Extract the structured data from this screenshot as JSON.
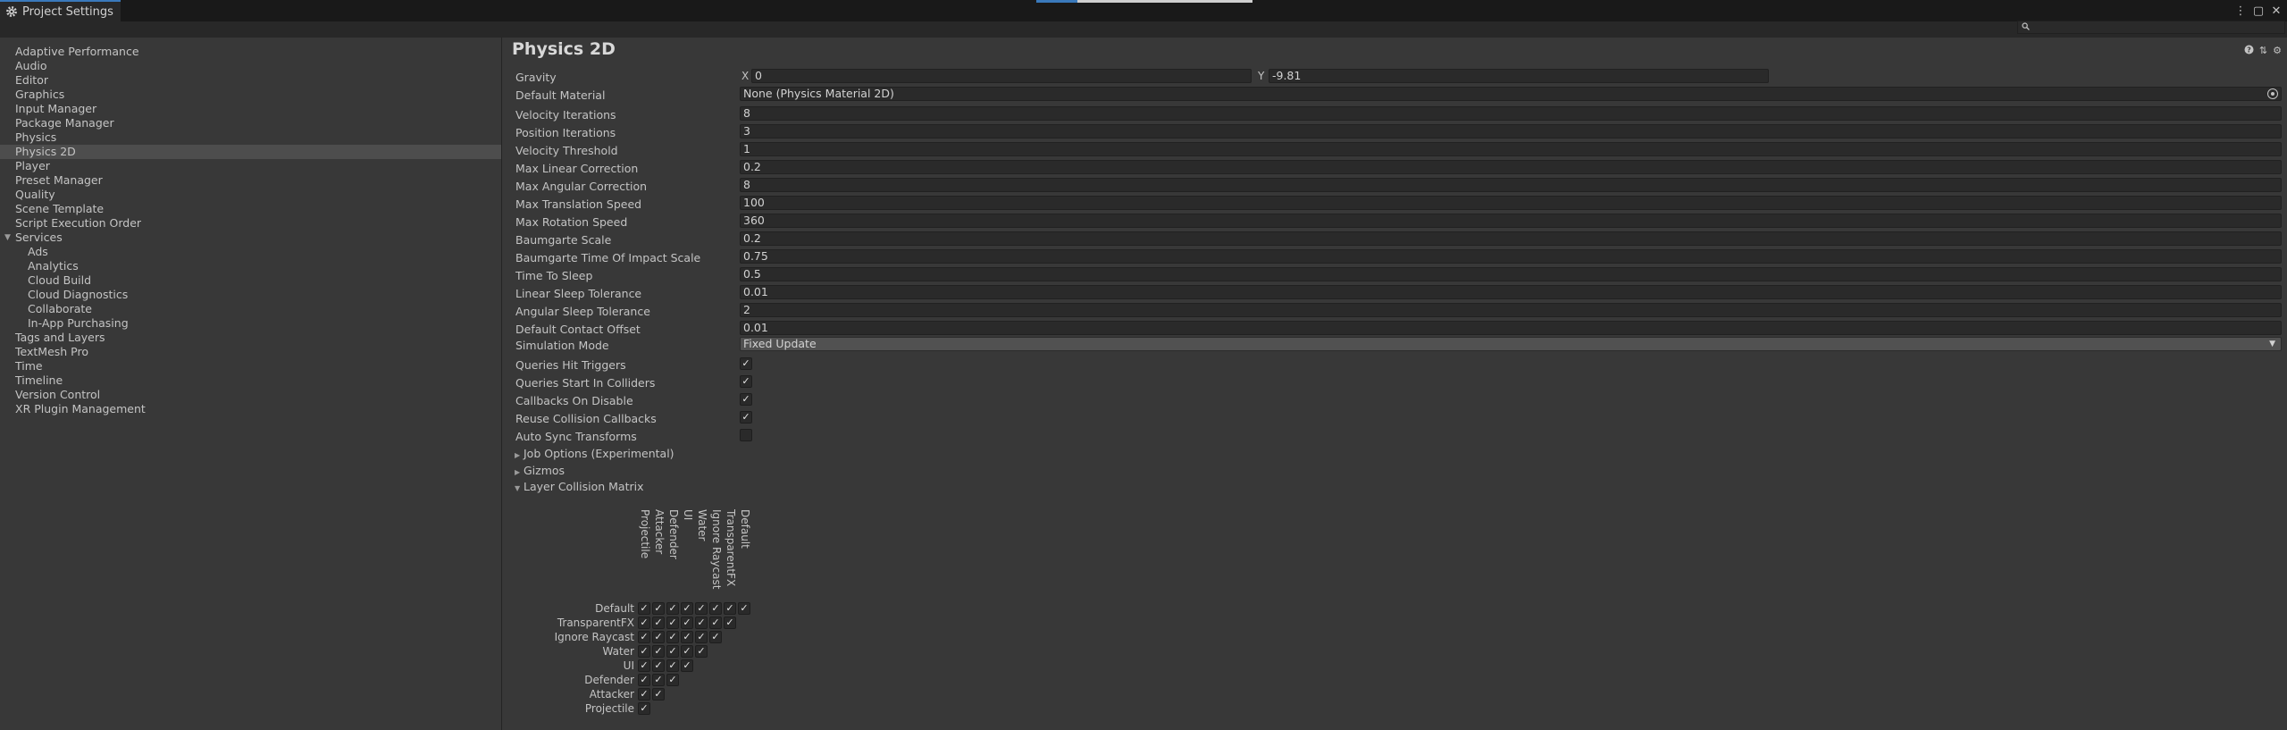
{
  "window": {
    "tab_title": "Project Settings",
    "icons": [
      "gear-icon",
      "more-vertical-icon",
      "maximize-icon",
      "close-icon"
    ]
  },
  "search": {
    "value": "",
    "icon": "search-icon"
  },
  "sidebar": {
    "selected": "Physics 2D",
    "items": [
      {
        "label": "Adaptive Performance",
        "indent": 0
      },
      {
        "label": "Audio",
        "indent": 0
      },
      {
        "label": "Editor",
        "indent": 0
      },
      {
        "label": "Graphics",
        "indent": 0
      },
      {
        "label": "Input Manager",
        "indent": 0
      },
      {
        "label": "Package Manager",
        "indent": 0
      },
      {
        "label": "Physics",
        "indent": 0
      },
      {
        "label": "Physics 2D",
        "indent": 0
      },
      {
        "label": "Player",
        "indent": 0
      },
      {
        "label": "Preset Manager",
        "indent": 0
      },
      {
        "label": "Quality",
        "indent": 0
      },
      {
        "label": "Scene Template",
        "indent": 0
      },
      {
        "label": "Script Execution Order",
        "indent": 0
      },
      {
        "label": "Services",
        "indent": 0,
        "expanded": true
      },
      {
        "label": "Ads",
        "indent": 1
      },
      {
        "label": "Analytics",
        "indent": 1
      },
      {
        "label": "Cloud Build",
        "indent": 1
      },
      {
        "label": "Cloud Diagnostics",
        "indent": 1
      },
      {
        "label": "Collaborate",
        "indent": 1
      },
      {
        "label": "In-App Purchasing",
        "indent": 1
      },
      {
        "label": "Tags and Layers",
        "indent": 0
      },
      {
        "label": "TextMesh Pro",
        "indent": 0
      },
      {
        "label": "Time",
        "indent": 0
      },
      {
        "label": "Timeline",
        "indent": 0
      },
      {
        "label": "Version Control",
        "indent": 0
      },
      {
        "label": "XR Plugin Management",
        "indent": 0
      }
    ]
  },
  "main": {
    "title": "Physics 2D",
    "header_icons": [
      "help-icon",
      "presets-icon",
      "settings-icon"
    ],
    "gravity": {
      "label": "Gravity",
      "x_label": "X",
      "x": "0",
      "y_label": "Y",
      "y": "-9.81"
    },
    "default_material": {
      "label": "Default Material",
      "value": "None (Physics Material 2D)"
    },
    "fields": [
      {
        "label": "Velocity Iterations",
        "value": "8"
      },
      {
        "label": "Position Iterations",
        "value": "3"
      },
      {
        "label": "Velocity Threshold",
        "value": "1"
      },
      {
        "label": "Max Linear Correction",
        "value": "0.2"
      },
      {
        "label": "Max Angular Correction",
        "value": "8"
      },
      {
        "label": "Max Translation Speed",
        "value": "100"
      },
      {
        "label": "Max Rotation Speed",
        "value": "360"
      },
      {
        "label": "Baumgarte Scale",
        "value": "0.2"
      },
      {
        "label": "Baumgarte Time Of Impact Scale",
        "value": "0.75"
      },
      {
        "label": "Time To Sleep",
        "value": "0.5"
      },
      {
        "label": "Linear Sleep Tolerance",
        "value": "0.01"
      },
      {
        "label": "Angular Sleep Tolerance",
        "value": "2"
      },
      {
        "label": "Default Contact Offset",
        "value": "0.01"
      }
    ],
    "simulation_mode": {
      "label": "Simulation Mode",
      "value": "Fixed Update"
    },
    "toggles": [
      {
        "label": "Queries Hit Triggers",
        "checked": true
      },
      {
        "label": "Queries Start In Colliders",
        "checked": true
      },
      {
        "label": "Callbacks On Disable",
        "checked": true
      },
      {
        "label": "Reuse Collision Callbacks",
        "checked": true
      },
      {
        "label": "Auto Sync Transforms",
        "checked": false
      }
    ],
    "foldouts": [
      {
        "label": "Job Options (Experimental)",
        "expanded": false
      },
      {
        "label": "Gizmos",
        "expanded": false
      },
      {
        "label": "Layer Collision Matrix",
        "expanded": true
      }
    ],
    "check_mark": "✓",
    "matrix": {
      "rows": [
        "Default",
        "TransparentFX",
        "Ignore Raycast",
        "Water",
        "UI",
        "Defender",
        "Attacker",
        "Projectile"
      ],
      "columns": [
        "Projectile",
        "Attacker",
        "Defender",
        "UI",
        "Water",
        "Ignore Raycast",
        "TransparentFX",
        "Default"
      ],
      "all_checked": true
    }
  }
}
